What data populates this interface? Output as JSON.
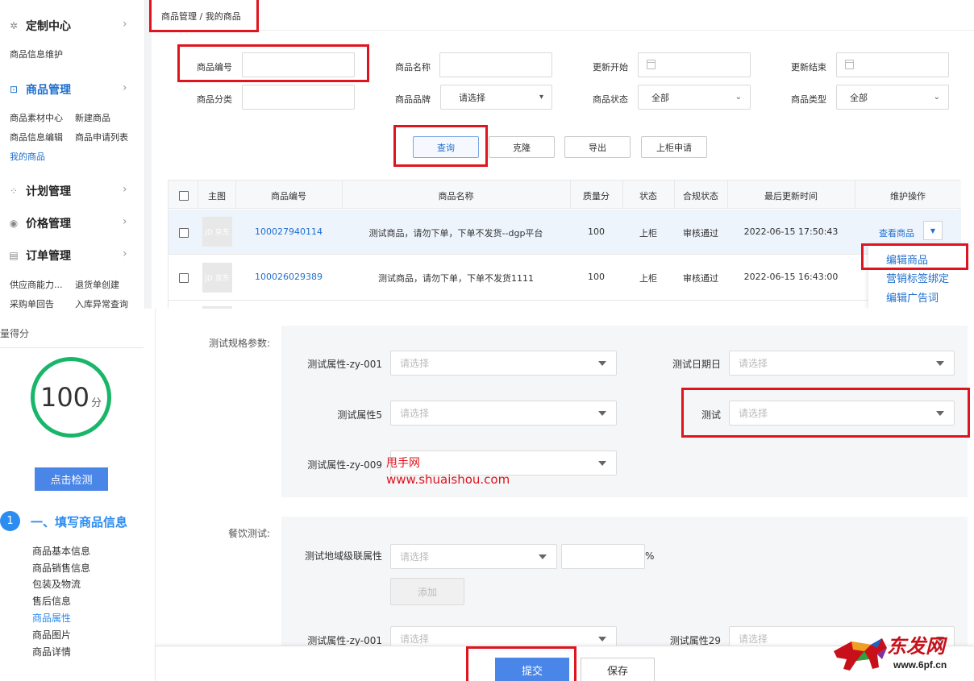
{
  "top": {
    "sidebar": {
      "groups": [
        {
          "title": "定制中心",
          "icon": "custom-icon",
          "items": [
            "商品信息维护"
          ]
        },
        {
          "title": "商品管理",
          "icon": "goods-icon",
          "items": [
            "商品素材中心",
            "新建商品",
            "商品信息编辑",
            "商品申请列表",
            "我的商品"
          ]
        },
        {
          "title": "计划管理",
          "icon": "plan-icon",
          "items": []
        },
        {
          "title": "价格管理",
          "icon": "price-icon",
          "items": []
        },
        {
          "title": "订单管理",
          "icon": "order-icon",
          "items": [
            "供应商能力...",
            "退货单创建",
            "采购单回告",
            "入库异常查询"
          ]
        }
      ],
      "arrow": "›"
    },
    "breadcrumb": "商品管理 / 我的商品",
    "filters": {
      "product_no_label": "商品编号",
      "product_name_label": "商品名称",
      "update_start_label": "更新开始",
      "update_end_label": "更新结束",
      "category_label": "商品分类",
      "brand_label": "商品品牌",
      "brand_value": "请选择",
      "status_label": "商品状态",
      "status_value": "全部",
      "type_label": "商品类型",
      "type_value": "全部"
    },
    "buttons": {
      "query": "查询",
      "clone": "克隆",
      "export": "导出",
      "shelf_apply": "上柜申请"
    },
    "table": {
      "headers": [
        "主图",
        "商品编号",
        "商品名称",
        "质量分",
        "状态",
        "合规状态",
        "最后更新时间",
        "维护操作"
      ],
      "rows": [
        {
          "thumb": "JD 京东",
          "product_no": "100027940114",
          "name": "测试商品，请勿下单，下单不发货--dgp平台",
          "score": "100",
          "status": "上柜",
          "compliance": "审核通过",
          "updated": "2022-06-15 17:50:43",
          "action": "查看商品"
        },
        {
          "thumb": "JD 京东",
          "product_no": "100026029389",
          "name": "测试商品，请勿下单，下单不发货1111",
          "score": "100",
          "status": "上柜",
          "compliance": "审核通过",
          "updated": "2022-06-15 16:43:00",
          "action": ""
        }
      ]
    },
    "dropdown_menu": [
      "编辑商品",
      "营销标签绑定",
      "编辑广告词"
    ]
  },
  "bottom": {
    "sidebar": {
      "cut_text": "量得分",
      "score": "100",
      "score_unit": "分",
      "check_button": "点击检测",
      "step_number": "1",
      "step_title": "一、填写商品信息",
      "items": [
        "商品基本信息",
        "商品销售信息",
        "包装及物流",
        "售后信息",
        "商品属性",
        "商品图片",
        "商品详情"
      ],
      "active_item": "商品属性"
    },
    "spec_params": {
      "group_label": "测试规格参数:",
      "fields": [
        {
          "label": "测试属性-zy-001",
          "placeholder": "请选择"
        },
        {
          "label": "测试日期日",
          "placeholder": "请选择"
        },
        {
          "label": "测试属性5",
          "placeholder": "请选择"
        },
        {
          "label": "测试",
          "placeholder": "请选择"
        },
        {
          "label": "测试属性-zy-009",
          "placeholder": ""
        }
      ]
    },
    "watermark": {
      "line1": "甩手网",
      "line2": "www.shuaishou.com"
    },
    "food_test": {
      "group_label": "餐饮测试:",
      "region_label": "测试地域级联属性",
      "region_placeholder": "请选择",
      "percent": "%",
      "add_button": "添加",
      "fields": [
        {
          "label": "测试属性-zy-001",
          "placeholder": "请选择"
        },
        {
          "label": "测试属性29",
          "placeholder": "请选择"
        }
      ]
    },
    "footer": {
      "submit": "提交",
      "save": "保存"
    },
    "logo": {
      "text": "东发网",
      "url": "www.6pf.cn"
    }
  },
  "colors": {
    "accent": "#1f6fcf",
    "highlight": "#e0141e",
    "success": "#19b66a",
    "primary_button": "#4a86e8"
  }
}
